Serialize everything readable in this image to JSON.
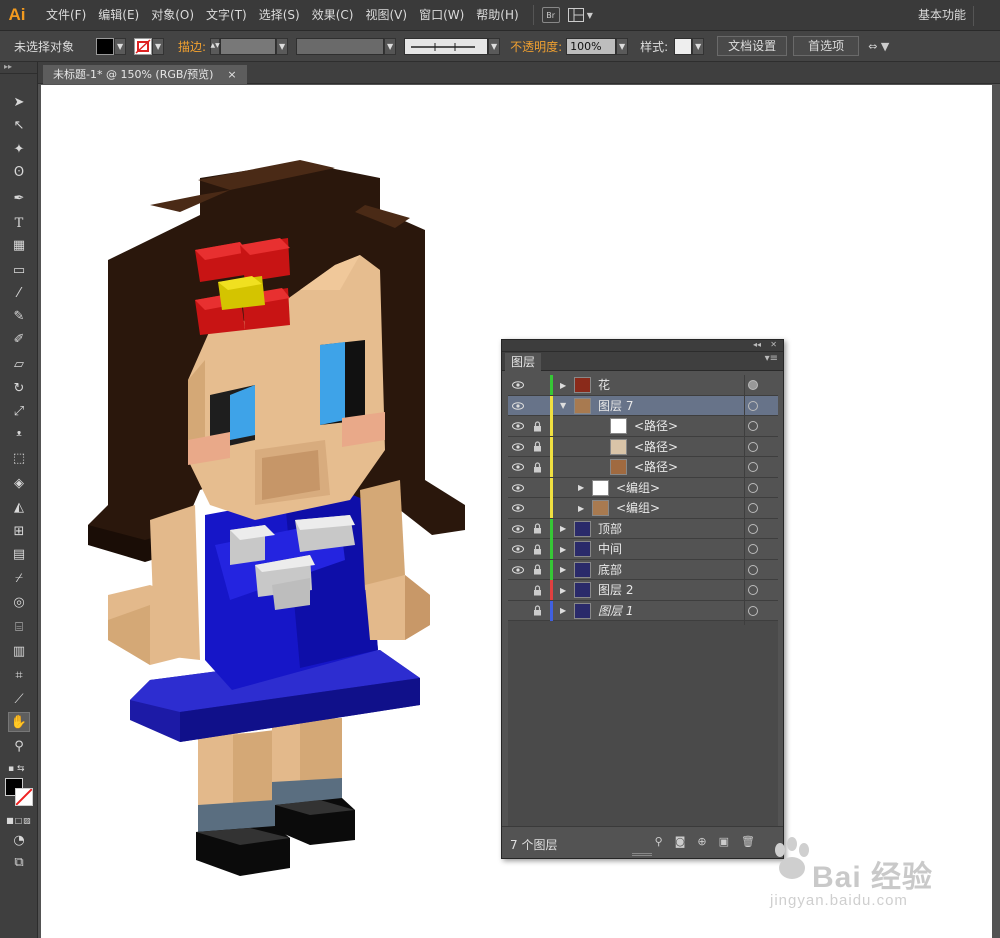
{
  "app": {
    "logo": "Ai",
    "menu": [
      "文件(F)",
      "编辑(E)",
      "对象(O)",
      "文字(T)",
      "选择(S)",
      "效果(C)",
      "视图(V)",
      "窗口(W)",
      "帮助(H)"
    ],
    "bridge_label": "Br",
    "workspace": "基本功能"
  },
  "control_bar": {
    "selection_status": "未选择对象",
    "stroke_label": "描边:",
    "opacity_label": "不透明度:",
    "opacity_value": "100%",
    "style_label": "样式:",
    "doc_setup_button": "文档设置",
    "prefs_button": "首选项"
  },
  "document_tab": {
    "title": "未标题-1* @ 150% (RGB/预览)",
    "close": "×"
  },
  "layers_panel": {
    "tab_label": "图层",
    "count_label": "7 个图层",
    "rows": [
      {
        "name": "花",
        "visible": true,
        "locked": false,
        "color": "#36c836",
        "level": 0,
        "expander": "▶",
        "selected": false,
        "italic": false,
        "target_filled": true,
        "thumb": "#8a2a1a"
      },
      {
        "name": "图层 7",
        "visible": true,
        "locked": false,
        "color": "#f0e040",
        "level": 0,
        "expander": "▼",
        "selected": true,
        "italic": false,
        "target_filled": false,
        "thumb": "#a87a50"
      },
      {
        "name": "<路径>",
        "visible": true,
        "locked": true,
        "color": "#f0e040",
        "level": 2,
        "expander": "",
        "selected": false,
        "italic": false,
        "target_filled": false,
        "thumb": "#ffffff"
      },
      {
        "name": "<路径>",
        "visible": true,
        "locked": true,
        "color": "#f0e040",
        "level": 2,
        "expander": "",
        "selected": false,
        "italic": false,
        "target_filled": false,
        "thumb": "#d9c4a8"
      },
      {
        "name": "<路径>",
        "visible": true,
        "locked": true,
        "color": "#f0e040",
        "level": 2,
        "expander": "",
        "selected": false,
        "italic": false,
        "target_filled": false,
        "thumb": "#a06a40"
      },
      {
        "name": "<编组>",
        "visible": true,
        "locked": false,
        "color": "#f0e040",
        "level": 1,
        "expander": "▶",
        "selected": false,
        "italic": false,
        "target_filled": false,
        "thumb": "#ffffff"
      },
      {
        "name": "<编组>",
        "visible": true,
        "locked": false,
        "color": "#f0e040",
        "level": 1,
        "expander": "▶",
        "selected": false,
        "italic": false,
        "target_filled": false,
        "thumb": "#a87a50"
      },
      {
        "name": "顶部",
        "visible": true,
        "locked": true,
        "color": "#36c836",
        "level": 0,
        "expander": "▶",
        "selected": false,
        "italic": false,
        "target_filled": false,
        "thumb": "#2a2a6a"
      },
      {
        "name": "中间",
        "visible": true,
        "locked": true,
        "color": "#36c836",
        "level": 0,
        "expander": "▶",
        "selected": false,
        "italic": false,
        "target_filled": false,
        "thumb": "#2a2a6a"
      },
      {
        "name": "底部",
        "visible": true,
        "locked": true,
        "color": "#36c836",
        "level": 0,
        "expander": "▶",
        "selected": false,
        "italic": false,
        "target_filled": false,
        "thumb": "#2a2a6a"
      },
      {
        "name": "图层 2",
        "visible": false,
        "locked": true,
        "color": "#e04040",
        "level": 0,
        "expander": "▶",
        "selected": false,
        "italic": false,
        "target_filled": false,
        "thumb": "#2a2a6a"
      },
      {
        "name": "图层 1",
        "visible": false,
        "locked": true,
        "color": "#4060e0",
        "level": 0,
        "expander": "▶",
        "selected": false,
        "italic": true,
        "target_filled": false,
        "thumb": "#2a2a6a"
      }
    ]
  },
  "watermark": {
    "brand": "Bai 经验",
    "url": "jingyan.baidu.com"
  }
}
